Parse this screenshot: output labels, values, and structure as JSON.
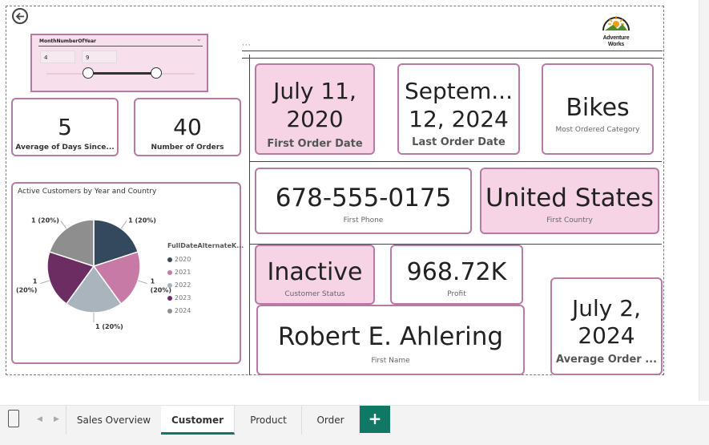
{
  "slicer": {
    "title": "MonthNumberOfYear",
    "min_value": "4",
    "max_value": "9",
    "range_start_fraction": 0.29,
    "range_end_fraction": 0.76
  },
  "kpis": {
    "avg_days": {
      "value": "5",
      "label": "Average of Days Since..."
    },
    "num_orders": {
      "value": "40",
      "label": "Number of Orders"
    },
    "first_order": {
      "value_line1": "July 11,",
      "value_line2": "2020",
      "label": "First Order Date"
    },
    "last_order": {
      "value_line1": "Septem...",
      "value_line2": "12, 2024",
      "label": "Last Order Date"
    },
    "category": {
      "value": "Bikes",
      "label": "Most Ordered Category"
    },
    "phone": {
      "value": "678-555-0175",
      "label": "First Phone"
    },
    "country": {
      "value": "United States",
      "label": "First Country"
    },
    "status": {
      "value": "Inactive",
      "label": "Customer Status"
    },
    "profit": {
      "value": "968.72K",
      "label": "Profit"
    },
    "name": {
      "value": "Robert E. Ahlering",
      "label": "First Name"
    },
    "avg_order": {
      "value_line1": "July 2,",
      "value_line2": "2024",
      "label": "Average Order ..."
    }
  },
  "logo": {
    "line1": "Adventure",
    "line2": "Works"
  },
  "chart_data": {
    "type": "pie",
    "title": "Active Customers by Year and Country",
    "legend_title": "FullDateAlternateK...",
    "series": [
      {
        "name": "2020",
        "value": 1,
        "percent": "20%",
        "color": "#34495e"
      },
      {
        "name": "2021",
        "value": 1,
        "percent": "20%",
        "color": "#c77aa6"
      },
      {
        "name": "2022",
        "value": 1,
        "percent": "20%",
        "color": "#aab4bd"
      },
      {
        "name": "2023",
        "value": 1,
        "percent": "20%",
        "color": "#6b2d62"
      },
      {
        "name": "2024",
        "value": 1,
        "percent": "20%",
        "color": "#8e8e8e"
      }
    ],
    "data_labels": [
      "1 (20%)",
      "1 (20%)",
      "1 (20%)",
      "1 (20%)",
      "1 (20%)"
    ],
    "legend_position": "right"
  },
  "tabs": {
    "items": [
      "Sales Overview",
      "Customer",
      "Product",
      "Order"
    ],
    "active": "Customer",
    "add_label": "+"
  },
  "colors": {
    "accent_border": "#b77aa5",
    "card_pink": "#f6d4e5",
    "tab_accent": "#117865"
  }
}
